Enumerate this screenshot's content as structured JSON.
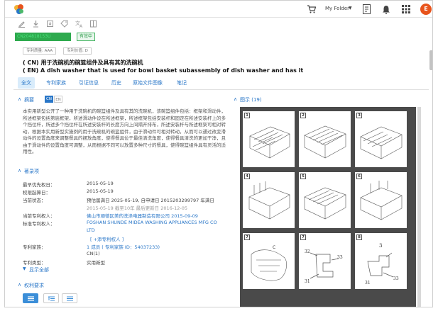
{
  "topbar": {
    "folder_label": "My Folder",
    "avatar_initial": "E"
  },
  "doc": {
    "pub_no": "CN204818153U",
    "status": "有效中",
    "tags": [
      "专利质量: AAA",
      "专利价值: D"
    ],
    "title_cn": "( CN) 用于洗碗机的碗篮组件及具有其的洗碗机",
    "title_en": "( EN) A dish washer that is used for bowl basket subassembly of dish washer and has it"
  },
  "tabs": [
    "全文",
    "专利家族",
    "引证信息",
    "历史",
    "原始文件图像",
    "笔记"
  ],
  "abstract": {
    "heading": "摘要",
    "lang_cn": "CN",
    "lang_en": "EN",
    "text": "本实用新型公开了一种用于洗碗机的碗篮组件及具有其的洗碗机，该碗篮组件包括：框架和滑动件，所述框架包括第底框架，所述滑动件设在所述框架，所述框架包括安装杆和固定在所述安装杆上的多个挡位杆，所述多个挡位杆在所述安装杆的长度方向上间隔开排布，所述安装杆与所述框架可相对转动，根据本实用新型实施例的用于洗碗机的碗篮组件，由于滑动件可相对转动，从而可以通过改变滑动件的设置角度来调整餐具的摆放角度，使得餐具位于最佳清洗角度，使得餐具清洗的更加干净，且由于滑动件的设置角度可调整，从而根据不同可以放置多种尺寸的餐具，使得碗篮组件具有灵活的适用性。"
  },
  "biblio": {
    "heading": "著录项",
    "fields": [
      {
        "label": "最早优先权日：",
        "value": "2015-05-19"
      },
      {
        "label": "权限起算日：",
        "value": "2015-05-19"
      },
      {
        "label": "当前状态：",
        "value": "预估届满日 2025-05-19, 自申请日 2015203299797 年满日",
        "value2": "2015-05-19 截至10年 最后更新日 2016-12-05"
      },
      {
        "label": "当前专利权人：",
        "value": "佛山市顺德区美的洗涤电器制造有限公司 2015-09-09"
      },
      {
        "label": "标准专利权人：",
        "value": "FOSHAN SHUNDE MIDEA WASHING APPLIANCES MFG CO",
        "value2": "LTD",
        "value3": "[ +添专利权人 ]"
      },
      {
        "label": "专利家族：",
        "value": "1 成员 ( 专利家族 ID：54037233)",
        "value2": "CN(1)"
      },
      {
        "label": "专利类型：",
        "value": "实用新型"
      }
    ],
    "show_all": "显示全部"
  },
  "claims": {
    "heading": "权利要求"
  },
  "figures": {
    "heading": "图示 (19)",
    "items": [
      {
        "n": "1"
      },
      {
        "n": "2"
      },
      {
        "n": "3"
      },
      {
        "n": "4"
      },
      {
        "n": "5"
      },
      {
        "n": "6"
      },
      {
        "n": "7",
        "labels": [
          "32",
          "33",
          "31"
        ]
      },
      {
        "n": "8",
        "labels": [
          "3",
          "33",
          "31"
        ]
      },
      {
        "n": "9",
        "labels": [
          "C"
        ]
      }
    ]
  },
  "icons": {
    "logo": "app-logo",
    "cart": "shopping-cart-icon",
    "doc": "document-icon",
    "bell": "bell-icon",
    "grid": "apps-grid-icon",
    "toolbar": [
      "edit-icon",
      "download-icon",
      "save-icon",
      "tag-icon",
      "translate-icon",
      "book-icon"
    ]
  },
  "colors": {
    "accent": "#2a77c8",
    "status": "#2eaa4e",
    "avatar": "#e8541c"
  }
}
